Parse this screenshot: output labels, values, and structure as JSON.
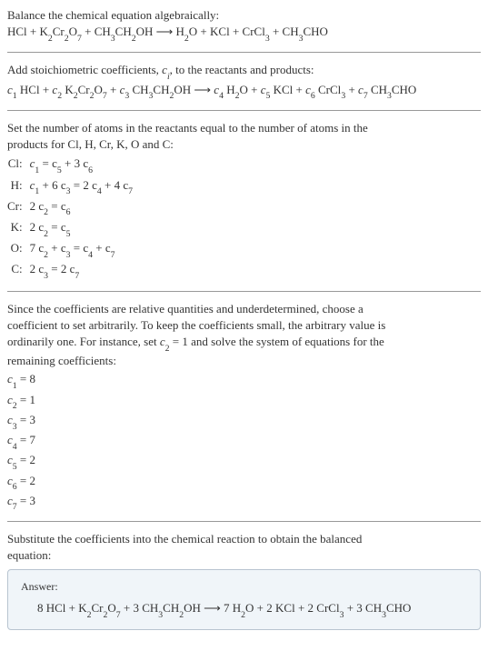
{
  "intro": {
    "line1": "Balance the chemical equation algebraically:",
    "equation_parts": [
      "HCl + K",
      "2",
      "Cr",
      "2",
      "O",
      "7",
      " + CH",
      "3",
      "CH",
      "2",
      "OH  ⟶  H",
      "2",
      "O + KCl + CrCl",
      "3",
      " + CH",
      "3",
      "CHO"
    ]
  },
  "stoich": {
    "line1_a": "Add stoichiometric coefficients, ",
    "line1_ci": "c",
    "line1_i": "i",
    "line1_b": ", to the reactants and products:",
    "eq": {
      "c1": "c",
      "n1": "1",
      "t1": " HCl + ",
      "c2": "c",
      "n2": "2",
      "t2": " K",
      "s2a": "2",
      "t2a": "Cr",
      "s2b": "2",
      "t2b": "O",
      "s2c": "7",
      "t2c": " + ",
      "c3": "c",
      "n3": "3",
      "t3": " CH",
      "s3a": "3",
      "t3a": "CH",
      "s3b": "2",
      "t3b": "OH  ⟶  ",
      "c4": "c",
      "n4": "4",
      "t4": " H",
      "s4a": "2",
      "t4a": "O + ",
      "c5": "c",
      "n5": "5",
      "t5": " KCl + ",
      "c6": "c",
      "n6": "6",
      "t6": " CrCl",
      "s6a": "3",
      "t6a": " + ",
      "c7": "c",
      "n7": "7",
      "t7": " CH",
      "s7a": "3",
      "t7a": "CHO"
    }
  },
  "atoms": {
    "intro1": "Set the number of atoms in the reactants equal to the number of atoms in the",
    "intro2": "products for Cl, H, Cr, K, O and C:",
    "rows": [
      {
        "label": "Cl:",
        "eq": [
          "c",
          "1",
          " = c",
          "5",
          " + 3 c",
          "6"
        ]
      },
      {
        "label": "H:",
        "eq": [
          "c",
          "1",
          " + 6 c",
          "3",
          " = 2 c",
          "4",
          " + 4 c",
          "7"
        ]
      },
      {
        "label": "Cr:",
        "eq": [
          "2 c",
          "2",
          " = c",
          "6"
        ]
      },
      {
        "label": "K:",
        "eq": [
          "2 c",
          "2",
          " = c",
          "5"
        ]
      },
      {
        "label": "O:",
        "eq": [
          "7 c",
          "2",
          " + c",
          "3",
          " = c",
          "4",
          " + c",
          "7"
        ]
      },
      {
        "label": "C:",
        "eq": [
          "2 c",
          "3",
          " = 2 c",
          "7"
        ]
      }
    ]
  },
  "choose": {
    "p1": "Since the coefficients are relative quantities and underdetermined, choose a",
    "p2": "coefficient to set arbitrarily. To keep the coefficients small, the arbitrary value is",
    "p3a": "ordinarily one. For instance, set ",
    "p3c": "c",
    "p3n": "2",
    "p3b": " = 1 and solve the system of equations for the",
    "p4": "remaining coefficients:",
    "coeffs": [
      {
        "c": "c",
        "n": "1",
        "v": " = 8"
      },
      {
        "c": "c",
        "n": "2",
        "v": " = 1"
      },
      {
        "c": "c",
        "n": "3",
        "v": " = 3"
      },
      {
        "c": "c",
        "n": "4",
        "v": " = 7"
      },
      {
        "c": "c",
        "n": "5",
        "v": " = 2"
      },
      {
        "c": "c",
        "n": "6",
        "v": " = 2"
      },
      {
        "c": "c",
        "n": "7",
        "v": " = 3"
      }
    ]
  },
  "subst": {
    "line1": "Substitute the coefficients into the chemical reaction to obtain the balanced",
    "line2": "equation:"
  },
  "answer": {
    "label": "Answer:",
    "eq": [
      "8 HCl + K",
      "2",
      "Cr",
      "2",
      "O",
      "7",
      " + 3 CH",
      "3",
      "CH",
      "2",
      "OH  ⟶  7 H",
      "2",
      "O + 2 KCl + 2 CrCl",
      "3",
      " + 3 CH",
      "3",
      "CHO"
    ]
  }
}
